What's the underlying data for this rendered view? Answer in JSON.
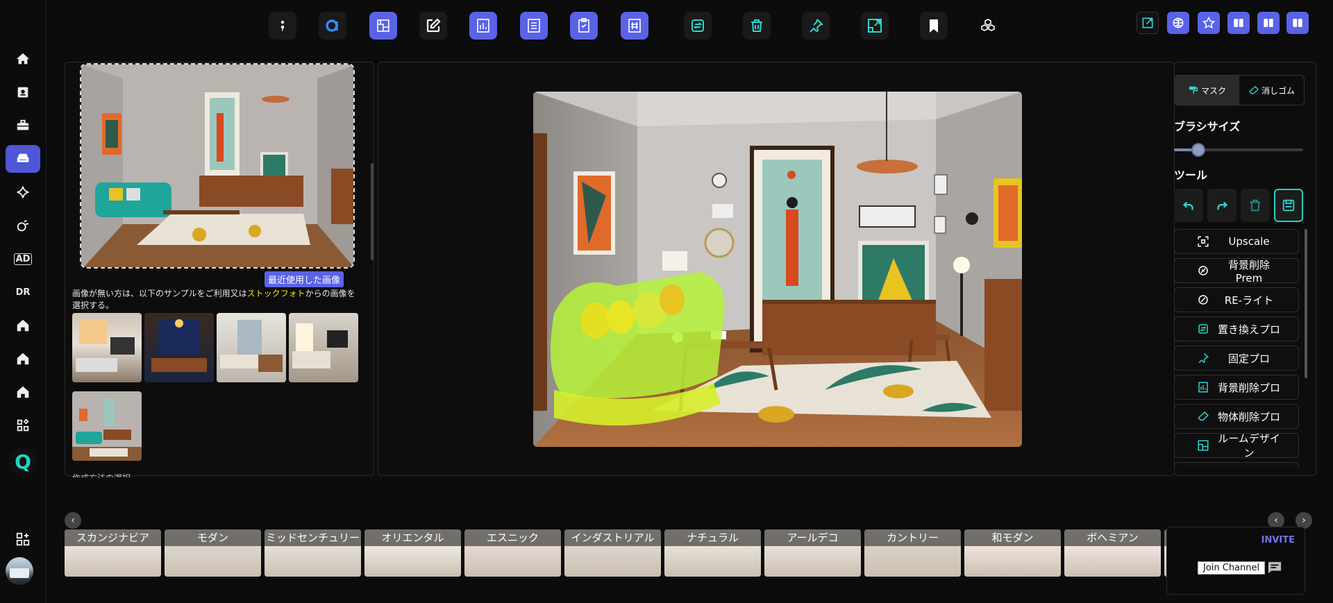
{
  "sidebar": {
    "items": [
      {
        "icon": "home-icon"
      },
      {
        "icon": "contact-card-icon"
      },
      {
        "icon": "toolbox-icon"
      },
      {
        "icon": "sofa-icon",
        "active": true
      },
      {
        "icon": "sparkle-icon"
      },
      {
        "icon": "paint-roller-icon"
      },
      {
        "icon": "ad-icon",
        "text": "AD"
      },
      {
        "icon": "dr-icon",
        "text": "DR"
      },
      {
        "icon": "house-icon"
      },
      {
        "icon": "house-icon"
      },
      {
        "icon": "house-icon"
      },
      {
        "icon": "apps-grid-icon"
      },
      {
        "icon": "q-logo-icon",
        "text": "Q"
      }
    ],
    "bottom_icon": "widgets-icon"
  },
  "toolbar": {
    "buttons": [
      "semicolon-icon",
      "a-logo-icon",
      "blueprint-icon",
      "edit-icon",
      "chart-doc-icon",
      "list-doc-icon",
      "clipboard-icon",
      "hash-doc-icon",
      "replace-icon",
      "trash-icon",
      "pin-icon",
      "resize-icon",
      "bookmark-icon",
      "cubes-icon"
    ],
    "right_buttons": [
      "external-edit-icon",
      "globe-icon",
      "star-badge-icon",
      "panel-left-icon",
      "panel-center-icon",
      "panel-right-icon"
    ]
  },
  "left_panel": {
    "recent_label": "最近使用した画像",
    "notice_pre": "画像が無い方は、以下のサンプルをご利用又は",
    "notice_highlight": "ストックフォト",
    "notice_post": "からの画像を選択する。",
    "section_cut_label": "作成方法の選択"
  },
  "right_panel": {
    "tab_mask": "マスク",
    "tab_eraser": "消しゴム",
    "brush_size_label": "ブラシサイズ",
    "brush_size_fraction": 0.19,
    "tools_label": "ツール",
    "functions": [
      {
        "label": "Upscale",
        "icon": "upscale-icon"
      },
      {
        "label": "背景削除Prem",
        "icon": "bg-remove-prem-icon"
      },
      {
        "label": "RE-ライト",
        "icon": "relight-icon"
      },
      {
        "label": "置き換えプロ",
        "icon": "replace-pro-icon"
      },
      {
        "label": "固定プロ",
        "icon": "pin-pro-icon"
      },
      {
        "label": "背景削除プロ",
        "icon": "bg-remove-pro-icon"
      },
      {
        "label": "物体削除プロ",
        "icon": "eraser-pro-icon"
      },
      {
        "label": "ルームデザイン",
        "icon": "room-design-icon"
      }
    ]
  },
  "styles": [
    "スカンジナビア",
    "モダン",
    "ミッドセンチュリー",
    "オリエンタル",
    "エスニック",
    "インダストリアル",
    "ナチュラル",
    "アールデコ",
    "カントリー",
    "和モダン",
    "ボヘミアン",
    "テ"
  ],
  "chat": {
    "invite": "INVITE",
    "join": "Join Channel"
  },
  "colors": {
    "accent": "#5a63e6",
    "teal": "#22d3c0",
    "mask": "#b6f23a"
  }
}
